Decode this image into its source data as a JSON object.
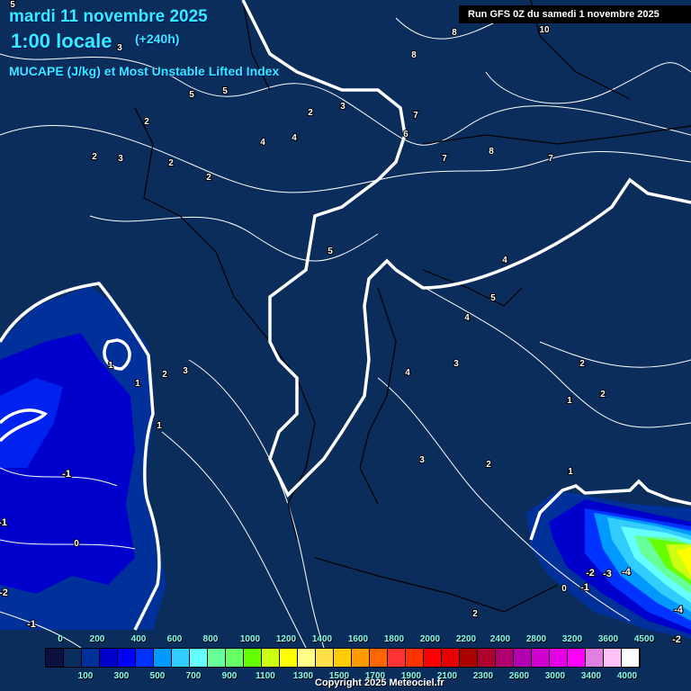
{
  "header": {
    "date": "mardi 11 novembre 2025",
    "time": "1:00 locale",
    "lead": "(+240h)",
    "parameter": "MUCAPE (J/kg) et Most Unstable Lifted Index",
    "run": "Run GFS 0Z du samedi 1 novembre 2025"
  },
  "map": {
    "background_color": "#0b2d5c",
    "lifted_index_labels": [
      "5",
      "3",
      "8",
      "10",
      "8",
      "5",
      "5",
      "2",
      "2",
      "3",
      "7",
      "6",
      "4",
      "4",
      "2",
      "3",
      "2",
      "2",
      "7",
      "8",
      "7",
      "5",
      "4",
      "5",
      "4",
      "1",
      "1",
      "2",
      "3",
      "4",
      "3",
      "2",
      "1",
      "2",
      "1",
      "3",
      "2",
      "-1",
      "1",
      "-1",
      "0",
      "-2",
      "-3",
      "-4",
      "0",
      "-1",
      "-2",
      "-1",
      "2",
      "-4",
      "-2"
    ]
  },
  "legend": {
    "colors": [
      "#0a1040",
      "#0b2d5c",
      "#00309a",
      "#0000cc",
      "#0000ff",
      "#0033ff",
      "#0099ff",
      "#33ccff",
      "#66ffff",
      "#66ff99",
      "#66ff66",
      "#66ff00",
      "#ccff11",
      "#ffff00",
      "#ffff88",
      "#ffe04a",
      "#ffcc00",
      "#ff9900",
      "#ff6600",
      "#ff3333",
      "#ff3300",
      "#ff0000",
      "#e60000",
      "#aa0000",
      "#b00030",
      "#b00070",
      "#b000b0",
      "#d000d0",
      "#e600e6",
      "#ff00ff",
      "#e080e0",
      "#ffc0f8",
      "#ffffff"
    ],
    "top_labels": [
      "0",
      "200",
      "400",
      "600",
      "800",
      "1000",
      "1200",
      "1400",
      "1600",
      "1800",
      "2000",
      "2200",
      "2400",
      "2800",
      "3200",
      "3600",
      "4500"
    ],
    "bottom_labels": [
      "100",
      "300",
      "500",
      "700",
      "900",
      "1100",
      "1300",
      "1500",
      "1700",
      "1900",
      "2100",
      "2300",
      "2600",
      "3000",
      "3400",
      "4000"
    ]
  },
  "footer": {
    "copyright": "Copyright 2025 Meteociel.fr"
  }
}
